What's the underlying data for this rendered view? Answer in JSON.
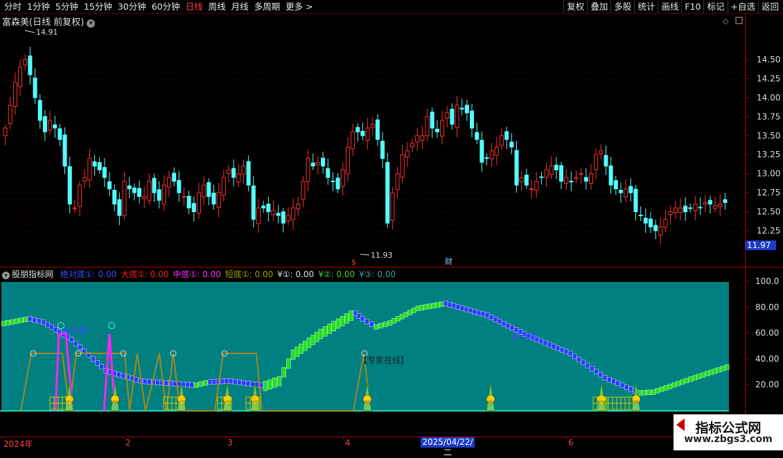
{
  "toolbar": {
    "periods": [
      "分时",
      "1分钟",
      "5分钟",
      "15分钟",
      "30分钟",
      "60分钟",
      "日线",
      "周线",
      "月线",
      "多周期",
      "更多 >"
    ],
    "active": "日线",
    "actions": [
      "复权",
      "叠加",
      "多股",
      "统计",
      "画线",
      "F10",
      "标记",
      "+自选",
      "返回"
    ]
  },
  "main": {
    "title": "富森美(日线 前复权)",
    "y_ticks": [
      "14.50",
      "14.25",
      "14.00",
      "13.75",
      "13.50",
      "13.25",
      "13.00",
      "12.75",
      "12.50",
      "12.25"
    ],
    "current_price": "11.97",
    "high_label": "14.91",
    "low_label": "11.93",
    "marker_s": "$",
    "marker_cai": "财"
  },
  "indicator": {
    "name": "股朋指标网",
    "items": [
      {
        "label": "绝对底①: 0.00",
        "color": "#3a4cff"
      },
      {
        "label": "大底①: 0.00",
        "color": "#ff2020"
      },
      {
        "label": "中底①: 0.00",
        "color": "#ff30ff"
      },
      {
        "label": "短底①: 0.00",
        "color": "#a0a000"
      },
      {
        "label": "¥①: 0.00",
        "color": "#e0e0e0"
      },
      {
        "label": "¥②: 0.00",
        "color": "#40d040"
      },
      {
        "label": "¥③: 0.00",
        "color": "#40a0a0"
      }
    ],
    "y_ticks": [
      "100.0",
      "80.00",
      "60.00",
      "40.00",
      "20.00"
    ],
    "text_hold": "持币期",
    "text_expert": "【专家在线】",
    "num1": "①",
    "num2": "②",
    "num3": "③"
  },
  "dates": {
    "labels": [
      {
        "t": "2024年",
        "x": 5
      },
      {
        "t": "2",
        "x": 181
      },
      {
        "t": "3",
        "x": 328
      },
      {
        "t": "4",
        "x": 498
      },
      {
        "t": "6",
        "x": 820
      }
    ],
    "selected": "2025/04/22/二"
  },
  "watermark": {
    "title": "指标公式网",
    "url": "www.zbgs3.com"
  },
  "colors": {
    "up": "#ff3030",
    "down": "#54ffff",
    "indicator_bg": "#008080",
    "green_band": "#22dd22",
    "blue_band": "#2a3cff",
    "olive": "#a08a20",
    "magenta": "#ff22ff"
  }
}
